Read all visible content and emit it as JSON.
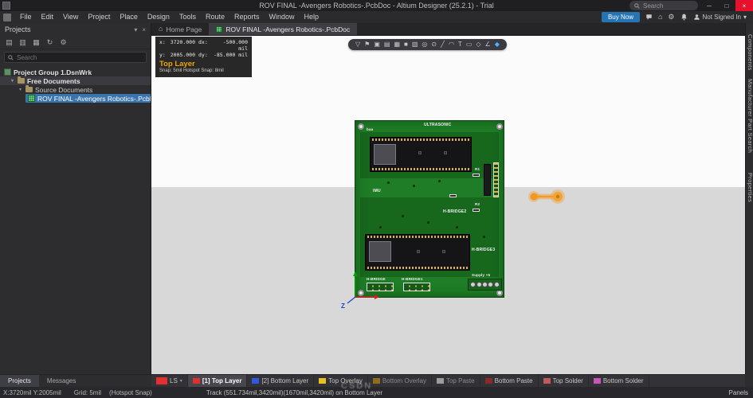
{
  "window": {
    "title": "ROV FINAL -Avengers Robotics-.PcbDoc - Altium Designer (25.2.1) - Trial",
    "search_placeholder": "Search"
  },
  "icons": {
    "minimize": "─",
    "maximize": "□",
    "close": "×",
    "home": "⌂",
    "gear": "⚙",
    "caret_down": "▾",
    "panel_caret": "▾",
    "panel_close": "×",
    "tree_expand": "▾",
    "ls_caret": "▾",
    "projects_toolbar": [
      "▤",
      "▥",
      "▦",
      "↻",
      "⚙"
    ],
    "float_toolbar": [
      "▽",
      "⚑",
      "▣",
      "▤",
      "▦",
      "■",
      "▧",
      "◎",
      "⊙",
      "╱",
      "◠",
      "T",
      "▭",
      "◇",
      "∠",
      "◆"
    ]
  },
  "menu": {
    "items": [
      "File",
      "Edit",
      "View",
      "Project",
      "Place",
      "Design",
      "Tools",
      "Route",
      "Reports",
      "Window",
      "Help"
    ],
    "buy_now": "Buy Now",
    "not_signed_in": "Not Signed In"
  },
  "projects_panel": {
    "title": "Projects",
    "search_placeholder": "Search",
    "tree": [
      {
        "label": "Project Group 1.DsnWrk"
      },
      {
        "label": "Free Documents"
      },
      {
        "label": "Source Documents"
      },
      {
        "label": "ROV FINAL -Avengers Robotics-.PcbDoc"
      }
    ]
  },
  "doc_tabs": {
    "home": "Home Page",
    "active": "ROV FINAL -Avengers Robotics-.PcbDoc"
  },
  "hud": {
    "row1_k": "x:",
    "row1_v": "3720.000",
    "row1_k2": "dx:",
    "row1_v2": "-500.000 mil",
    "row2_k": "y:",
    "row2_v": "2005.000",
    "row2_k2": "dy:",
    "row2_v2": "-85.000 mil",
    "layer": "Top Layer",
    "snap": "Snap: 5mil Hotspot Snap: 8mil"
  },
  "board": {
    "silkscreen": {
      "corner": "baa",
      "ultrasonic": "ULTRASONIC",
      "imu": "IMU",
      "r1": "R1",
      "r2": "R2",
      "h_bridge2": "H-BRIDGE2",
      "h_bridge3": "H-BRIDGE3",
      "h_bridge": "H-BRIDGE",
      "h_bridge1": "H-BRIDGE1",
      "supply": "Supply +5"
    }
  },
  "misc": {
    "origin_z": "Z"
  },
  "layer_bar": {
    "ls": "LS",
    "ls_color": "#e03030",
    "items": [
      {
        "label": "[1] Top Layer",
        "color": "#e03030"
      },
      {
        "label": "[2] Bottom Layer",
        "color": "#3058e0"
      },
      {
        "label": "Top Overlay",
        "color": "#e8c020"
      },
      {
        "label": "Bottom Overlay",
        "color": "#8f6c1e"
      },
      {
        "label": "Top Paste",
        "color": "#9c9c9c"
      },
      {
        "label": "Bottom Paste",
        "color": "#8a2a2a"
      },
      {
        "label": "Top Solder",
        "color": "#c05a5a"
      },
      {
        "label": "Bottom Solder",
        "color": "#c858b8"
      }
    ]
  },
  "bottom_tabs": {
    "projects": "Projects",
    "messages": "Messages"
  },
  "right_tabs": {
    "components": "Components",
    "mps": "Manufacturer Part Search",
    "properties": "Properties"
  },
  "status": {
    "coords": "X:3720mil Y:2005mil",
    "grid": "Grid: 5mil",
    "snap": "(Hotspot Snap)",
    "message": "Track (551.734mil,3420mil)(1670mil,3420mil) on Bottom Layer",
    "panels": "Panels"
  },
  "watermark": "CSDN"
}
